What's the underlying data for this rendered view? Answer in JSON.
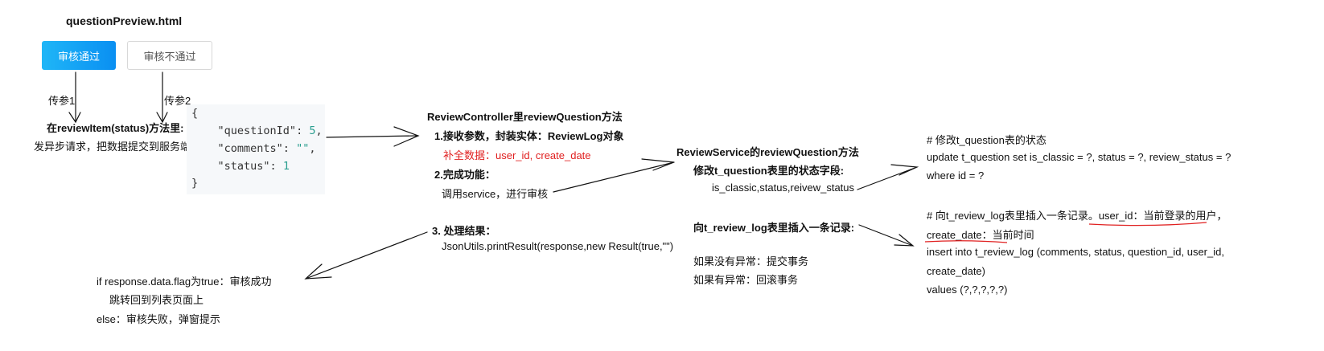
{
  "title": "questionPreview.html",
  "buttons": {
    "approve": "审核通过",
    "reject": "审核不通过"
  },
  "params": {
    "p1": "传参1",
    "p2": "传参2"
  },
  "review_item": {
    "heading": "在reviewItem(status)方法里:",
    "desc": "发异步请求，把数据提交到服务端"
  },
  "code": {
    "open": "{",
    "lines": [
      {
        "key": "\"questionId\"",
        "value": "5",
        "value_type": "number",
        "tail": ","
      },
      {
        "key": "\"comments\"",
        "value": "\"\"",
        "value_type": "string",
        "tail": ","
      },
      {
        "key": "\"status\"",
        "value": "1",
        "value_type": "number",
        "tail": ""
      }
    ],
    "close": "}"
  },
  "controller": {
    "title": "ReviewController里reviewQuestion方法",
    "step1": "1.接收参数，封装实体：ReviewLog对象",
    "step1_note": "补全数据：user_id, create_date",
    "step2": "2.完成功能：",
    "step2_desc": "调用service，进行审核",
    "step3": "3. 处理结果：",
    "step3_desc": "JsonUtils.printResult(response,new Result(true,\"\")"
  },
  "result": {
    "line1": "if response.data.flag为true：审核成功",
    "line2": "跳转回到列表页面上",
    "line3": "else：审核失败，弹窗提示"
  },
  "service": {
    "title": "ReviewService的reviewQuestion方法",
    "modify_heading": "修改t_question表里的状态字段:",
    "modify_fields": "is_classic,status,reivew_status",
    "insert_heading": "向t_review_log表里插入一条记录:",
    "on_ok": "如果没有异常：提交事务",
    "on_err": "如果有异常：回滚事务"
  },
  "sql_update": {
    "comment": "# 修改t_question表的状态",
    "line1": "update t_question set is_classic = ?, status = ?, review_status = ?",
    "line2": "where id = ?"
  },
  "sql_insert": {
    "comment_a": "# 向t_review_log表里插入一条记录。",
    "comment_b": "user_id：当前登录的用户，",
    "comment_c": "create_date：当前时间",
    "line1": "insert into t_review_log (comments, status, question_id, user_id,",
    "line2": "create_date)",
    "line3": "values (?,?,?,?,?)"
  },
  "colors": {
    "accent": "#0a8ff2",
    "highlight": "#e02020"
  }
}
